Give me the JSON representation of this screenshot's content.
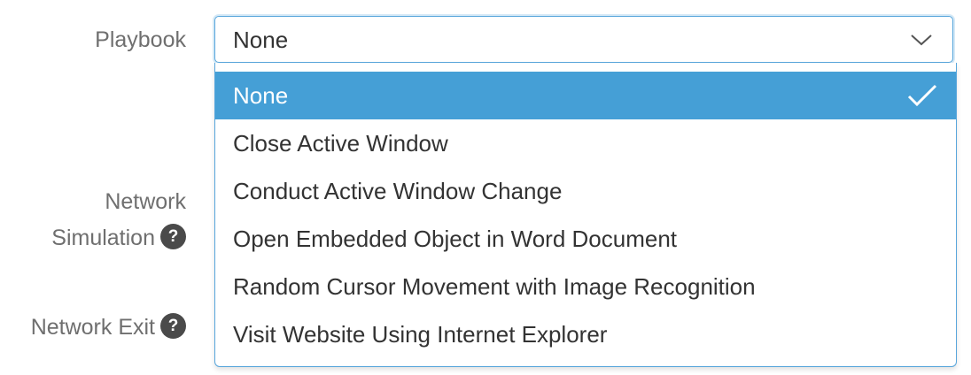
{
  "form": {
    "playbook_label": "Playbook",
    "network_simulation_label_line1": "Network",
    "network_simulation_label_line2": "Simulation",
    "network_exit_label": "Network Exit",
    "help_glyph": "?"
  },
  "playbook_select": {
    "value": "None",
    "options": [
      {
        "label": "None",
        "selected": true
      },
      {
        "label": "Close Active Window",
        "selected": false
      },
      {
        "label": "Conduct Active Window Change",
        "selected": false
      },
      {
        "label": "Open Embedded Object in Word Document",
        "selected": false
      },
      {
        "label": "Random Cursor Movement with Image Recognition",
        "selected": false
      },
      {
        "label": "Visit Website Using Internet Explorer",
        "selected": false
      }
    ]
  },
  "colors": {
    "accent": "#459fd6",
    "focus_border": "#58a6dc",
    "label_text": "#6f6f6f",
    "help_icon_bg": "#4a4a4a"
  },
  "icons": {
    "dropdown": "chevron-down-icon",
    "selected": "checkmark-icon",
    "help": "question-circle-icon"
  }
}
